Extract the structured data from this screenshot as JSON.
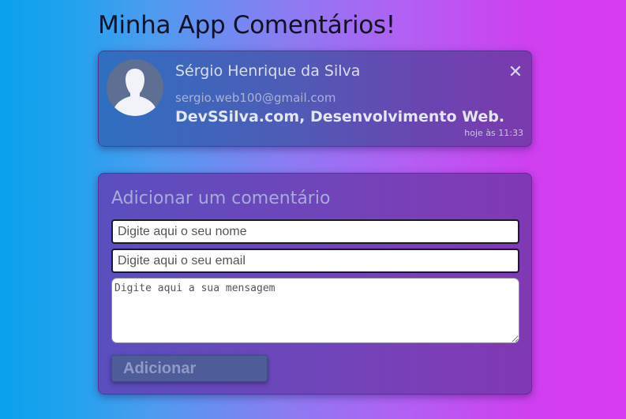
{
  "page": {
    "title": "Minha App Comentários!"
  },
  "comment": {
    "author_name": "Sérgio Henrique da Silva",
    "author_email": "sergio.web100@gmail.com",
    "text": "DevSSilva.com, Desenvolvimento Web.",
    "timestamp": "hoje às 11:33",
    "close_symbol": "✕",
    "avatar_icon": "user-silhouette-icon"
  },
  "form": {
    "title": "Adicionar um comentário",
    "name_placeholder": "Digite aqui o seu nome",
    "name_value": "",
    "email_placeholder": "Digite aqui o seu email",
    "email_value": "",
    "message_placeholder": "Digite aqui a sua mensagem",
    "message_value": "",
    "submit_label": "Adicionar"
  },
  "colors": {
    "background_start": "#0aa1ec",
    "background_end": "#d83bf0",
    "comment_card": "#4f5bb6",
    "form_card": "#6b47bb",
    "button": "#4f5c9a",
    "title_text": "#111122"
  }
}
